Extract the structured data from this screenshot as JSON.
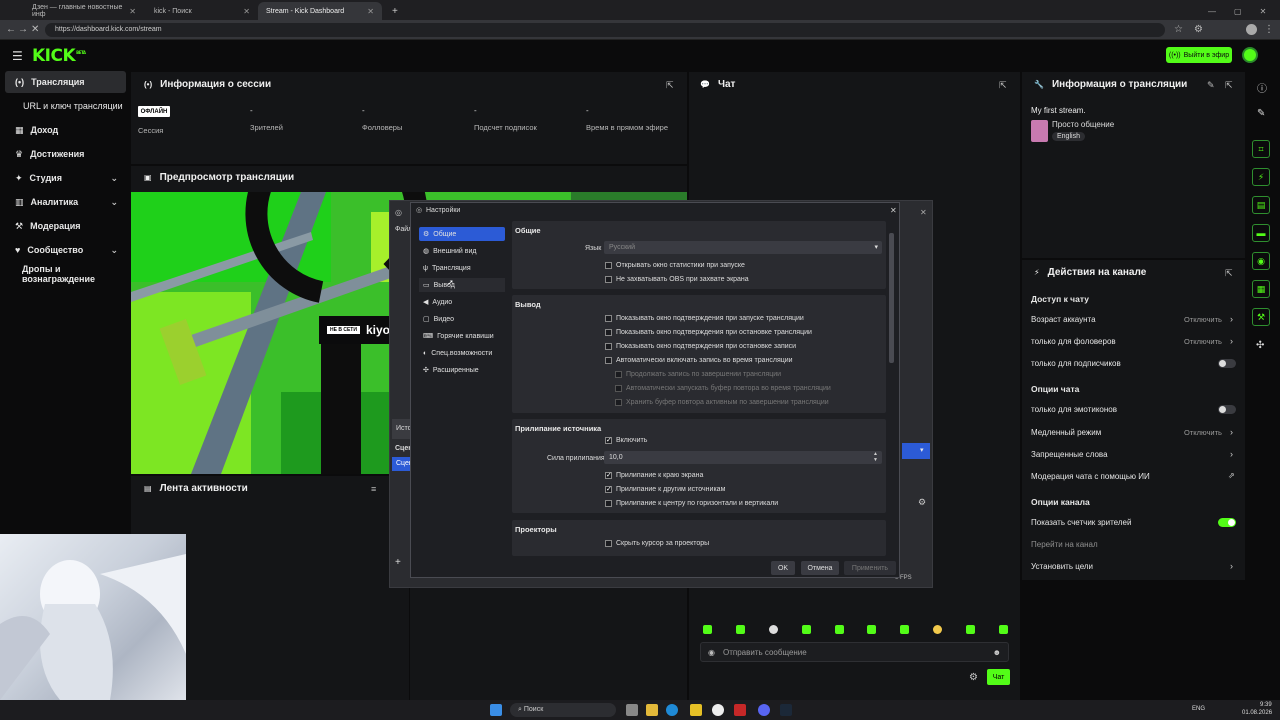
{
  "browser": {
    "tabs": [
      {
        "title": "Дзен — главные новостные инф"
      },
      {
        "title": "kick - Поиск"
      },
      {
        "title": "Stream - Kick Dashboard"
      }
    ],
    "url": "https://dashboard.kick.com/stream"
  },
  "header": {
    "logo": "KICK",
    "logo_badge": "BETA",
    "go_live": "Выйти в эфир"
  },
  "sidebar": {
    "items": [
      {
        "label": "Трансляция",
        "icon": "broadcast-icon"
      },
      {
        "label": "URL и ключ трансляции"
      },
      {
        "label": "Доход",
        "icon": "income-icon"
      },
      {
        "label": "Достижения",
        "icon": "trophy-icon"
      },
      {
        "label": "Студия",
        "icon": "studio-icon"
      },
      {
        "label": "Аналитика",
        "icon": "analytics-icon"
      },
      {
        "label": "Модерация",
        "icon": "moderation-icon"
      },
      {
        "label": "Сообщество",
        "icon": "community-icon"
      },
      {
        "label": "Дропы и вознаграждение"
      }
    ]
  },
  "session": {
    "title": "Информация о сессии",
    "status_badge": "ОФЛАЙН",
    "stats": [
      {
        "label": "Сессия",
        "value": ""
      },
      {
        "label": "Зрителей",
        "value": "-"
      },
      {
        "label": "Фолловеры",
        "value": "-"
      },
      {
        "label": "Подсчет подписок",
        "value": "-"
      },
      {
        "label": "Время в прямом эфире",
        "value": "-"
      }
    ]
  },
  "preview": {
    "title": "Предпросмотр трансляции",
    "overlay_badge": "НЕ В СЕТИ",
    "overlay_name": "kiyo"
  },
  "activity": {
    "title": "Лента активности"
  },
  "chat": {
    "title": "Чат",
    "input_placeholder": "Отправить сообщение",
    "send_label": "Чат"
  },
  "stream_info": {
    "title": "Информация о трансляции",
    "stream_title": "My first stream.",
    "category": "Просто общение",
    "language_tag": "English"
  },
  "channel_actions": {
    "title": "Действия на канале",
    "chat_access": {
      "heading": "Доступ к чату",
      "rows": [
        {
          "label": "Возраст аккаунта",
          "value": "Отключить"
        },
        {
          "label": "только для фоловеров",
          "value": "Отключить"
        },
        {
          "label": "только для подписчиков"
        }
      ]
    },
    "chat_options": {
      "heading": "Опции чата",
      "rows": [
        {
          "label": "только для эмотиконов"
        },
        {
          "label": "Медленный режим",
          "value": "Отключить"
        },
        {
          "label": "Запрещенные слова"
        },
        {
          "label": "Модерация чата с помощью ИИ"
        }
      ]
    },
    "channel_options": {
      "heading": "Опции канала",
      "rows": [
        {
          "label": "Показать счетчик зрителей"
        },
        {
          "label": "Перейти на канал"
        },
        {
          "label": "Установить цели"
        }
      ]
    }
  },
  "obs": {
    "menu_file": "Файл",
    "sources_label": "Исто",
    "scenes_label": "Сцен",
    "scene_item": "Сцен",
    "fps": "0 FPS",
    "settings": {
      "title": "Настройки",
      "nav": [
        {
          "label": "Общие",
          "icon": "gear-icon"
        },
        {
          "label": "Внешний вид",
          "icon": "palette-icon"
        },
        {
          "label": "Трансляция",
          "icon": "antenna-icon"
        },
        {
          "label": "Вывод",
          "icon": "output-icon"
        },
        {
          "label": "Аудио",
          "icon": "speaker-icon"
        },
        {
          "label": "Видео",
          "icon": "monitor-icon"
        },
        {
          "label": "Горячие клавиши",
          "icon": "keyboard-icon"
        },
        {
          "label": "Спец.возможности",
          "icon": "accessibility-icon"
        },
        {
          "label": "Расширенные",
          "icon": "wrench-icon"
        }
      ],
      "general": {
        "heading": "Общие",
        "language_label": "Язык",
        "language_value": "Русский",
        "checks": [
          {
            "label": "Открывать окно статистики при запуске",
            "checked": false
          },
          {
            "label": "Не захватывать OBS при захвате экрана",
            "checked": false
          }
        ]
      },
      "output": {
        "heading": "Вывод",
        "checks": [
          {
            "label": "Показывать окно подтверждения при запуске трансляции",
            "checked": false,
            "disabled": false
          },
          {
            "label": "Показывать окно подтверждения при остановке трансляции",
            "checked": false,
            "disabled": false
          },
          {
            "label": "Показывать окно подтверждения при остановке записи",
            "checked": false,
            "disabled": false
          },
          {
            "label": "Автоматически включать запись во время трансляции",
            "checked": false,
            "disabled": false
          },
          {
            "label": "Продолжать запись по завершении трансляции",
            "checked": false,
            "disabled": true
          },
          {
            "label": "Автоматически запускать буфер повтора во время трансляции",
            "checked": false,
            "disabled": true
          },
          {
            "label": "Хранить буфер повтора активным по завершении трансляции",
            "checked": false,
            "disabled": true
          }
        ]
      },
      "snapping": {
        "heading": "Прилипание источника",
        "enable_label": "Включить",
        "strength_label": "Сила прилипания",
        "strength_value": "10,0",
        "checks": [
          {
            "label": "Прилипание к краю экрана",
            "checked": true
          },
          {
            "label": "Прилипание к другим источникам",
            "checked": true
          },
          {
            "label": "Прилипание к центру по горизонтали и вертикали",
            "checked": false
          }
        ]
      },
      "projectors": {
        "heading": "Проекторы",
        "checks": [
          {
            "label": "Скрыть курсор за проекторы",
            "checked": false
          }
        ]
      },
      "buttons": {
        "ok": "OK",
        "cancel": "Отмена",
        "apply": "Применить"
      }
    }
  },
  "taskbar": {
    "search_placeholder": "Поиск",
    "lang": "ENG",
    "time": "9:39",
    "date": "01.08.2026"
  },
  "colors": {
    "accent": "#53fc18",
    "panel": "#141517",
    "obs_selected": "#2c5bd6"
  }
}
